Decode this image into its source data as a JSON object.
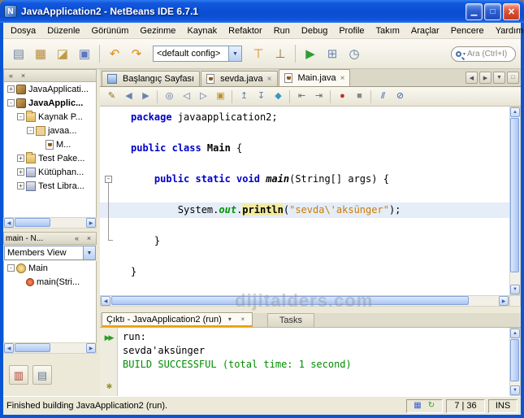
{
  "window": {
    "title": "JavaApplication2 - NetBeans IDE 6.7.1",
    "logo_letter": "N"
  },
  "icons": {
    "minimize_window": "▁",
    "maximize_window": "□",
    "close_window": "✕",
    "panel_minimize": "«",
    "panel_close": "×",
    "tab_close": "×",
    "dropdown": "▾",
    "scroll_left": "◀",
    "scroll_right": "▶",
    "scroll_up": "▲",
    "scroll_down": "▼",
    "tab_list": "▼",
    "maximize_view": "□"
  },
  "menubar": {
    "items": [
      "Dosya",
      "Düzenle",
      "Görünüm",
      "Gezinme",
      "Kaynak",
      "Refaktor",
      "Run",
      "Debug",
      "Profile",
      "Takım",
      "Araçlar",
      "Pencere",
      "Yardım"
    ]
  },
  "toolbar": {
    "group1": [
      {
        "name": "new-file-button",
        "glyph": "▤",
        "color": "#6A84A6"
      },
      {
        "name": "new-project-button",
        "glyph": "▦",
        "color": "#BA8A34"
      },
      {
        "name": "open-project-button",
        "glyph": "◪",
        "color": "#C09A48"
      },
      {
        "name": "save-all-button",
        "glyph": "▣",
        "color": "#5A78B8"
      },
      {
        "sep": true
      },
      {
        "name": "undo-button",
        "glyph": "↶",
        "color": "#E08818"
      },
      {
        "name": "redo-button",
        "glyph": "↷",
        "color": "#E08818"
      }
    ],
    "config_value": "<default config>",
    "group2": [
      {
        "name": "build-project-button",
        "glyph": "⊤",
        "color": "#D8860C"
      },
      {
        "name": "clean-build-button",
        "glyph": "⊥",
        "color": "#9A6A28"
      },
      {
        "sep": true
      },
      {
        "name": "run-project-button",
        "glyph": "▶",
        "color": "#2E9E30"
      },
      {
        "name": "debug-project-button",
        "glyph": "⊞",
        "color": "#6A86B8"
      },
      {
        "name": "profile-project-button",
        "glyph": "◷",
        "color": "#55789A"
      }
    ],
    "search_placeholder": "Ara (Ctrl+I)"
  },
  "projects_panel": {
    "tree": [
      {
        "label": "JavaApplicati...",
        "level": 0,
        "icon": "project",
        "expand": "+"
      },
      {
        "label": "JavaApplic...",
        "level": 0,
        "icon": "project",
        "expand": "-",
        "bold": true
      },
      {
        "label": "Kaynak P...",
        "level": 1,
        "icon": "folder",
        "expand": "-"
      },
      {
        "label": "javaa...",
        "level": 2,
        "icon": "package",
        "expand": "-"
      },
      {
        "label": "M...",
        "level": 3,
        "icon": "javafile"
      },
      {
        "label": "Test Pake...",
        "level": 1,
        "icon": "folder",
        "expand": "+"
      },
      {
        "label": "Kütüphan...",
        "level": 1,
        "icon": "libs",
        "expand": "+"
      },
      {
        "label": "Test Libra...",
        "level": 1,
        "icon": "libs",
        "expand": "+"
      }
    ]
  },
  "navigator_panel": {
    "title": "main - N...",
    "view": "Members View",
    "tree": [
      {
        "label": "Main",
        "level": 0,
        "icon": "classnode",
        "expand": "-"
      },
      {
        "label": "main(Stri...",
        "level": 1,
        "icon": "method"
      }
    ]
  },
  "min_bar": {
    "buttons": [
      {
        "name": "minimized-window-button-1",
        "glyph": "▥",
        "color": "#B04030"
      },
      {
        "name": "minimized-window-button-2",
        "glyph": "▤",
        "color": "#607890"
      }
    ]
  },
  "editor": {
    "tabs": [
      {
        "label": "Başlangıç Sayfası",
        "icon": "start",
        "closable": false,
        "active": false
      },
      {
        "label": "sevda.java",
        "icon": "java",
        "closable": true,
        "active": false
      },
      {
        "label": "Main.java",
        "icon": "java",
        "closable": true,
        "active": true
      }
    ],
    "code_lines": [
      {
        "tokens": [
          {
            "t": "package ",
            "s": "kw"
          },
          {
            "t": "javaapplication2;",
            "s": "pl"
          }
        ]
      },
      {
        "tokens": []
      },
      {
        "tokens": [
          {
            "t": "public class ",
            "s": "kw"
          },
          {
            "t": "Main",
            "s": "cls"
          },
          {
            "t": " {",
            "s": "pl"
          }
        ]
      },
      {
        "tokens": []
      },
      {
        "fold": "-",
        "tokens": [
          {
            "t": "    ",
            "s": "pl"
          },
          {
            "t": "public static void ",
            "s": "kw"
          },
          {
            "t": "main",
            "s": "mth"
          },
          {
            "t": "(String[] args) {",
            "s": "pl"
          }
        ]
      },
      {
        "tokens": []
      },
      {
        "current": true,
        "tokens": [
          {
            "t": "        System.",
            "s": "pl"
          },
          {
            "t": "out",
            "s": "fld"
          },
          {
            "t": ".",
            "s": "pl"
          },
          {
            "t": "println",
            "s": "occ"
          },
          {
            "t": "(",
            "s": "pl"
          },
          {
            "t": "\"sevda\\'aksünger\"",
            "s": "str"
          },
          {
            "t": ");",
            "s": "pl"
          }
        ]
      },
      {
        "tokens": []
      },
      {
        "tokens": [
          {
            "t": "    }",
            "s": "pl"
          }
        ]
      },
      {
        "tokens": []
      },
      {
        "tokens": [
          {
            "t": "}",
            "s": "pl"
          }
        ]
      }
    ]
  },
  "editor_toolbar": {
    "buttons": [
      {
        "name": "last-edit-button",
        "glyph": "✎",
        "color": "#8A6A20"
      },
      {
        "name": "back-button",
        "glyph": "◀",
        "color": "#6A84B0"
      },
      {
        "name": "forward-button",
        "glyph": "▶",
        "color": "#6A84B0"
      },
      {
        "sep": true
      },
      {
        "name": "find-selection-button",
        "glyph": "◎",
        "color": "#50709E"
      },
      {
        "name": "find-previous-button",
        "glyph": "◁",
        "color": "#50709E"
      },
      {
        "name": "find-next-button",
        "glyph": "▷",
        "color": "#50709E"
      },
      {
        "name": "toggle-highlight-button",
        "glyph": "▣",
        "color": "#C09028"
      },
      {
        "sep": true
      },
      {
        "name": "previous-bookmark-button",
        "glyph": "↥",
        "color": "#5880B0"
      },
      {
        "name": "next-bookmark-button",
        "glyph": "↧",
        "color": "#5880B0"
      },
      {
        "name": "toggle-bookmark-button",
        "glyph": "◆",
        "color": "#3898C0"
      },
      {
        "sep": true
      },
      {
        "name": "shift-left-button",
        "glyph": "⇤",
        "color": "#6A6A58"
      },
      {
        "name": "shift-right-button",
        "glyph": "⇥",
        "color": "#6A6A58"
      },
      {
        "sep": true
      },
      {
        "name": "record-macro-button",
        "glyph": "●",
        "color": "#C03020"
      },
      {
        "name": "stop-macro-button",
        "glyph": "■",
        "color": "#8A8A80"
      },
      {
        "sep": true
      },
      {
        "name": "comment-button",
        "glyph": "//",
        "color": "#3A62A8"
      },
      {
        "name": "uncomment-button",
        "glyph": "⊘",
        "color": "#3A62A8"
      }
    ]
  },
  "output_panel": {
    "tab_label": "Çıktı - JavaApplication2 (run)",
    "tasks_label": "Tasks",
    "buttons": [
      {
        "name": "rerun-button",
        "glyph": "▶▶",
        "color": "#28A028"
      },
      {
        "name": "build-settings-button",
        "glyph": "✱",
        "color": "#98922E"
      }
    ],
    "lines": [
      {
        "text": "run:",
        "style": "plain"
      },
      {
        "text": "sevda'aksünger",
        "style": "plain"
      },
      {
        "text": "BUILD SUCCESSFUL (total time: 1 second)",
        "style": "success"
      }
    ]
  },
  "statusbar": {
    "message": "Finished building JavaApplication2 (run).",
    "caret": "7 | 36",
    "mode": "INS",
    "icons": [
      {
        "name": "notification-icon",
        "glyph": "▦",
        "color": "#3A62C8"
      },
      {
        "name": "refresh-icon",
        "glyph": "↻",
        "color": "#2E9E30"
      }
    ]
  },
  "watermark": "dijitalders.com"
}
